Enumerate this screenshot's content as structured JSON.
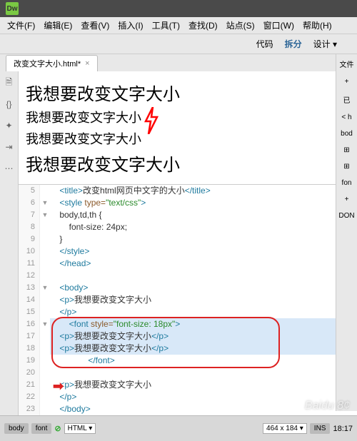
{
  "app": {
    "logo": "Dw"
  },
  "menu": {
    "file": "文件(F)",
    "edit": "编辑(E)",
    "view": "查看(V)",
    "insert": "插入(I)",
    "tool": "工具(T)",
    "find": "查找(D)",
    "site": "站点(S)",
    "window": "窗口(W)",
    "help": "帮助(H)"
  },
  "subtool": {
    "code": "代码",
    "split": "拆分",
    "design": "设计 ▾"
  },
  "tab": {
    "name": "改变文字大小.html*",
    "close": "×",
    "right": "文件"
  },
  "preview": {
    "line1": "我想要改变文字大小",
    "line2": "我想要改变文字大小",
    "line3": "我想要改变文字大小",
    "line4": "我想要改变文字大小"
  },
  "code": [
    {
      "n": "5",
      "g": "",
      "c": [
        [
          "    ",
          ""
        ],
        [
          "<title>",
          "tag"
        ],
        [
          "改变html网页中文字的大小",
          "txt"
        ],
        [
          "</title>",
          "tag"
        ]
      ]
    },
    {
      "n": "6",
      "g": "▼",
      "c": [
        [
          "    ",
          ""
        ],
        [
          "<style ",
          "tag"
        ],
        [
          "type=",
          "attr"
        ],
        [
          "\"text/css\"",
          "str"
        ],
        [
          ">",
          "tag"
        ]
      ]
    },
    {
      "n": "7",
      "g": "▼",
      "c": [
        [
          "    body,td,th {",
          "txt"
        ]
      ]
    },
    {
      "n": "8",
      "g": "",
      "c": [
        [
          "        font-size: 24px;",
          "txt"
        ]
      ]
    },
    {
      "n": "9",
      "g": "",
      "c": [
        [
          "    }",
          "txt"
        ]
      ]
    },
    {
      "n": "10",
      "g": "",
      "c": [
        [
          "    ",
          ""
        ],
        [
          "</style>",
          "tag"
        ]
      ]
    },
    {
      "n": "11",
      "g": "",
      "c": [
        [
          "    ",
          ""
        ],
        [
          "</head>",
          "tag"
        ]
      ]
    },
    {
      "n": "12",
      "g": "",
      "c": [
        [
          "",
          ""
        ]
      ]
    },
    {
      "n": "13",
      "g": "▼",
      "c": [
        [
          "    ",
          ""
        ],
        [
          "<body>",
          "tag"
        ]
      ]
    },
    {
      "n": "14",
      "g": "",
      "c": [
        [
          "    ",
          ""
        ],
        [
          "<p>",
          "tag"
        ],
        [
          "我想要改变文字大小",
          "txt"
        ]
      ]
    },
    {
      "n": "15",
      "g": "",
      "c": [
        [
          "    ",
          ""
        ],
        [
          "</p>",
          "tag"
        ]
      ]
    },
    {
      "n": "16",
      "g": "▼",
      "c": [
        [
          "        ",
          ""
        ],
        [
          "<font ",
          "tag"
        ],
        [
          "style=",
          "attr"
        ],
        [
          "\"font-size: 18px\"",
          "str"
        ],
        [
          ">",
          "tag"
        ]
      ],
      "hl": true
    },
    {
      "n": "17",
      "g": "",
      "c": [
        [
          "    ",
          ""
        ],
        [
          "<p>",
          "tag"
        ],
        [
          "我想要改变文字大小",
          "txt"
        ],
        [
          "</p>",
          "tag"
        ]
      ],
      "hl": true
    },
    {
      "n": "18",
      "g": "",
      "c": [
        [
          "    ",
          ""
        ],
        [
          "<p>",
          "tag"
        ],
        [
          "我想要改变文字大小",
          "txt"
        ],
        [
          "</p>",
          "tag"
        ]
      ],
      "hl": true
    },
    {
      "n": "19",
      "g": "",
      "c": [
        [
          "                ",
          ""
        ],
        [
          "</font>",
          "tag"
        ]
      ]
    },
    {
      "n": "20",
      "g": "",
      "c": [
        [
          "",
          ""
        ]
      ]
    },
    {
      "n": "21",
      "g": "",
      "c": [
        [
          "    ",
          ""
        ],
        [
          "<p>",
          "tag"
        ],
        [
          "我想要改变文字大小",
          "txt"
        ]
      ]
    },
    {
      "n": "22",
      "g": "",
      "c": [
        [
          "    ",
          ""
        ],
        [
          "</p>",
          "tag"
        ]
      ]
    },
    {
      "n": "23",
      "g": "",
      "c": [
        [
          "    ",
          ""
        ],
        [
          "</body>",
          "tag"
        ]
      ]
    }
  ],
  "rightpanel": {
    "p1": "+",
    "p2": "已",
    "p3": "< h",
    "p4": "bod",
    "p5": "⊞",
    "p6": "⊞",
    "p7": "fon",
    "p8": "+",
    "p9": "DON"
  },
  "status": {
    "body": "body",
    "font": "font",
    "ok": "⊘",
    "lang": "HTML",
    "langarrow": "▾",
    "dim": "464 x 184",
    "dimarrow": "▾",
    "ins": "INS",
    "time": "18:17"
  },
  "watermark": "Baidu 8¢"
}
